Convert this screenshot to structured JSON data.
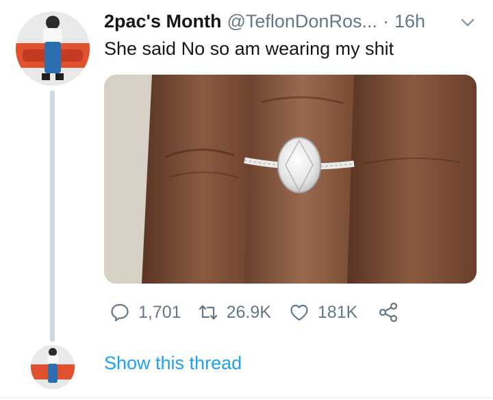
{
  "tweet": {
    "display_name": "2pac's Month",
    "handle": "@TeflonDonRos...",
    "separator": "·",
    "timestamp": "16h",
    "text": "She said No so am wearing my shit",
    "media_alt": "Photo of a diamond engagement ring on a finger"
  },
  "actions": {
    "replies": "1,701",
    "retweets": "26.9K",
    "likes": "181K"
  },
  "thread": {
    "show_label": "Show this thread"
  },
  "icons": {
    "reply": "reply-icon",
    "retweet": "retweet-icon",
    "like": "heart-icon",
    "share": "share-icon",
    "caret": "chevron-down-icon"
  },
  "colors": {
    "link": "#1da1f2",
    "secondary_text": "#657786",
    "thread_line": "#cfd9de"
  }
}
